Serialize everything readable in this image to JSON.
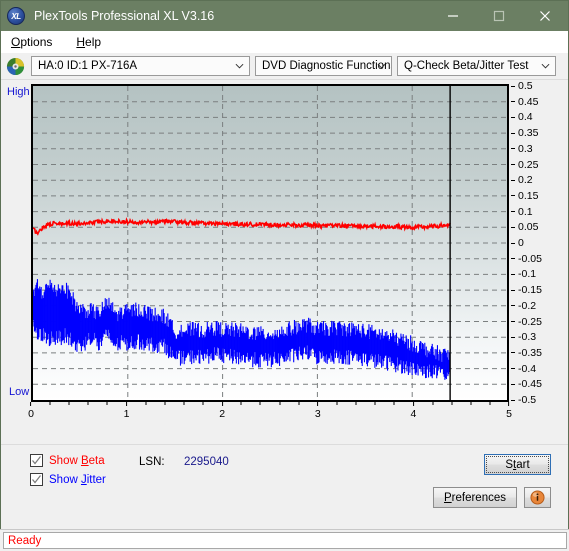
{
  "window": {
    "title": "PlexTools Professional XL V3.16",
    "logo_text": "XL",
    "minimize_label": "Minimize",
    "maximize_label": "Maximize",
    "close_label": "Close"
  },
  "menu": {
    "items": [
      {
        "label": "Options",
        "accel": "O"
      },
      {
        "label": "Help",
        "accel": "H"
      }
    ]
  },
  "toolbar": {
    "drive": "HA:0 ID:1  PX-716A",
    "function": "DVD Diagnostic Functions",
    "test": "Q-Check Beta/Jitter Test"
  },
  "chart_labels": {
    "high": "High",
    "low": "Low"
  },
  "controls": {
    "show_beta": {
      "label_pre": "Show ",
      "label_accel": "B",
      "label_post": "eta",
      "checked": true,
      "color": "#ff0000"
    },
    "show_jitter": {
      "label_pre": "Show ",
      "label_accel": "J",
      "label_post": "itter",
      "checked": true,
      "color": "#0000ff"
    },
    "lsn_label": "LSN:",
    "lsn_value": "2295040",
    "start_button": {
      "label_pre": "S",
      "label_accel": "t",
      "label_post": "art",
      "focused": true
    },
    "preferences_button": {
      "label_pre": "",
      "label_accel": "P",
      "label_post": "references"
    },
    "info_button_name": "info"
  },
  "status": {
    "text": "Ready"
  },
  "chart_data": {
    "type": "line",
    "title": "Q-Check Beta/Jitter Test",
    "xlabel": "",
    "ylabel": "",
    "xlim": [
      0,
      5
    ],
    "ylim": [
      -0.5,
      0.5
    ],
    "xticks": [
      0,
      1,
      2,
      3,
      4,
      5
    ],
    "yticks": [
      0.5,
      0.45,
      0.4,
      0.35,
      0.3,
      0.25,
      0.2,
      0.15,
      0.1,
      0.05,
      0,
      -0.05,
      -0.1,
      -0.15,
      -0.2,
      -0.25,
      -0.3,
      -0.35,
      -0.4,
      -0.45,
      -0.5
    ],
    "grid": true,
    "legend_position": "below-left",
    "data_end_x": 4.4,
    "marker_line_x": 4.4,
    "series": [
      {
        "name": "Beta",
        "color": "#ff0000",
        "type": "line",
        "x": [
          0.0,
          0.05,
          0.1,
          0.15,
          0.2,
          0.3,
          0.4,
          0.5,
          0.6,
          0.7,
          0.8,
          0.9,
          1.0,
          1.1,
          1.2,
          1.3,
          1.4,
          1.5,
          1.6,
          1.7,
          1.8,
          1.9,
          2.0,
          2.2,
          2.4,
          2.6,
          2.8,
          3.0,
          3.2,
          3.4,
          3.6,
          3.8,
          4.0,
          4.2,
          4.4
        ],
        "values": [
          0.045,
          0.03,
          0.05,
          0.058,
          0.062,
          0.06,
          0.063,
          0.062,
          0.065,
          0.068,
          0.07,
          0.069,
          0.068,
          0.067,
          0.068,
          0.067,
          0.07,
          0.068,
          0.066,
          0.064,
          0.063,
          0.062,
          0.061,
          0.06,
          0.059,
          0.058,
          0.057,
          0.056,
          0.055,
          0.054,
          0.053,
          0.052,
          0.05,
          0.052,
          0.058
        ]
      },
      {
        "name": "Jitter",
        "color": "#0000ff",
        "type": "band",
        "x": [
          0.0,
          0.05,
          0.1,
          0.15,
          0.2,
          0.25,
          0.3,
          0.35,
          0.4,
          0.45,
          0.5,
          0.55,
          0.6,
          0.65,
          0.7,
          0.75,
          0.8,
          0.85,
          0.9,
          0.95,
          1.0,
          1.1,
          1.2,
          1.3,
          1.4,
          1.5,
          1.55,
          1.6,
          1.7,
          1.8,
          1.9,
          2.0,
          2.2,
          2.4,
          2.6,
          2.8,
          2.9,
          3.0,
          3.2,
          3.4,
          3.6,
          3.8,
          4.0,
          4.2,
          4.4
        ],
        "upper": [
          -0.175,
          -0.13,
          -0.16,
          -0.14,
          -0.135,
          -0.15,
          -0.14,
          -0.15,
          -0.16,
          -0.2,
          -0.21,
          -0.215,
          -0.215,
          -0.22,
          -0.225,
          -0.2,
          -0.195,
          -0.215,
          -0.23,
          -0.215,
          -0.22,
          -0.21,
          -0.22,
          -0.23,
          -0.235,
          -0.285,
          -0.27,
          -0.28,
          -0.275,
          -0.28,
          -0.27,
          -0.275,
          -0.28,
          -0.29,
          -0.285,
          -0.265,
          -0.26,
          -0.275,
          -0.27,
          -0.275,
          -0.285,
          -0.3,
          -0.32,
          -0.345,
          -0.36
        ],
        "lower": [
          -0.26,
          -0.3,
          -0.29,
          -0.31,
          -0.3,
          -0.305,
          -0.3,
          -0.295,
          -0.31,
          -0.33,
          -0.325,
          -0.32,
          -0.3,
          -0.305,
          -0.33,
          -0.3,
          -0.295,
          -0.32,
          -0.325,
          -0.315,
          -0.32,
          -0.315,
          -0.32,
          -0.325,
          -0.33,
          -0.37,
          -0.365,
          -0.37,
          -0.36,
          -0.365,
          -0.355,
          -0.36,
          -0.365,
          -0.375,
          -0.37,
          -0.355,
          -0.35,
          -0.365,
          -0.36,
          -0.365,
          -0.375,
          -0.385,
          -0.4,
          -0.41,
          -0.42
        ]
      }
    ]
  }
}
